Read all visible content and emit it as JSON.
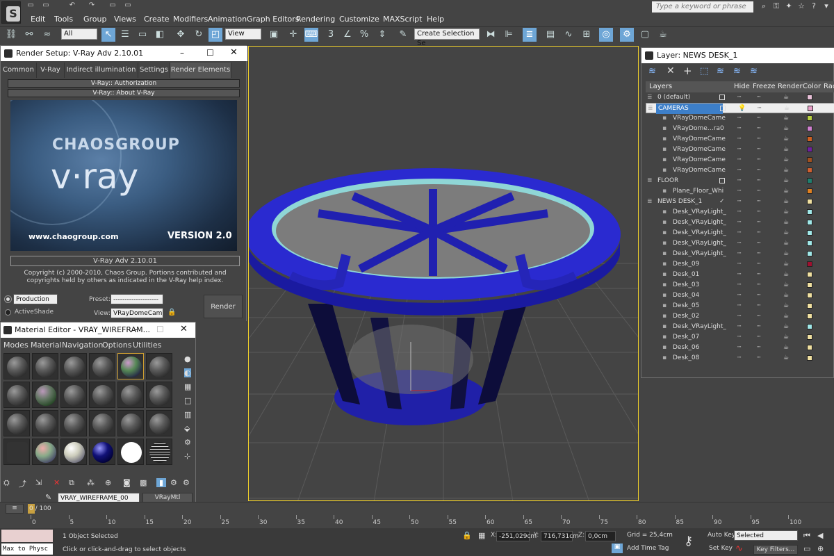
{
  "app": {
    "logo_glyph": "S"
  },
  "qat": [
    "▭",
    "▭",
    "↶",
    "↷",
    "▭",
    "▭"
  ],
  "menu": [
    "Edit",
    "Tools",
    "Group",
    "Views",
    "Create",
    "Modifiers",
    "Animation",
    "Graph Editors",
    "Rendering",
    "Customize",
    "MAXScript",
    "Help"
  ],
  "search": {
    "placeholder": "Type a keyword or phrase"
  },
  "toolbar": {
    "filter": "All",
    "ref_coord": "View",
    "named_selection": "Create Selection Se"
  },
  "render_setup": {
    "title": "Render Setup: V-Ray Adv 2.10.01",
    "tabs": [
      "Common",
      "V-Ray",
      "Indirect illumination",
      "Settings",
      "Render Elements"
    ],
    "rollout_auth": "V-Ray:: Authorization",
    "rollout_about": "V-Ray:: About V-Ray",
    "splash_brand": "CHAOSGROUP",
    "splash_product": "v·ray",
    "splash_url": "www.chaogroup.com",
    "splash_version": "VERSION 2.0",
    "version_label": "V-Ray Adv 2.10.01",
    "copyright": "Copyright (c) 2000-2010, Chaos Group. Portions contributed and copyrights held by others as indicated in the V-Ray help index.",
    "mode_production": "Production",
    "mode_activeshade": "ActiveShade",
    "preset_label": "Preset:",
    "preset_value": "--------------------",
    "view_label": "View:",
    "view_value": "VRayDomeCam",
    "render_button": "Render"
  },
  "material_editor": {
    "title": "Material Editor - VRAY_WIREFRAM...",
    "menu": [
      "Modes",
      "Material",
      "Navigation",
      "Options",
      "Utilities"
    ],
    "material_name": "VRAY_WIREFRAME_00",
    "material_type": "VRayMtl"
  },
  "layer_manager": {
    "title": "Layer: NEWS DESK_1",
    "columns": [
      "Layers",
      "Hide",
      "Freeze",
      "Render",
      "Color",
      "Rad"
    ],
    "rows": [
      {
        "name": "0 (default)",
        "level": 0,
        "color": "#e8c0d8"
      },
      {
        "name": "CAMERAS",
        "level": 0,
        "color": "#e8a0c8",
        "selected": true
      },
      {
        "name": "VRayDomeCame",
        "level": 1,
        "color": "#b8d040"
      },
      {
        "name": "VRayDome…ra0",
        "level": 1,
        "color": "#d080d0"
      },
      {
        "name": "VRayDomeCame",
        "level": 1,
        "color": "#d06020"
      },
      {
        "name": "VRayDomeCame",
        "level": 1,
        "color": "#7020a0"
      },
      {
        "name": "VRayDomeCame",
        "level": 1,
        "color": "#a05020"
      },
      {
        "name": "VRayDomeCame",
        "level": 1,
        "color": "#d06030"
      },
      {
        "name": "FLOOR",
        "level": 0,
        "color": "#208070"
      },
      {
        "name": "Plane_Floor_Whi",
        "level": 1,
        "color": "#e08020"
      },
      {
        "name": "NEWS DESK_1",
        "level": 0,
        "color": "#f0e0a0",
        "current": true
      },
      {
        "name": "Desk_VRayLight_",
        "level": 1,
        "color": "#a0e8e8"
      },
      {
        "name": "Desk_VRayLight_",
        "level": 1,
        "color": "#a0e8e8"
      },
      {
        "name": "Desk_VRayLight_",
        "level": 1,
        "color": "#a0e8e8"
      },
      {
        "name": "Desk_VRayLight_",
        "level": 1,
        "color": "#a0e8e8"
      },
      {
        "name": "Desk_VRayLight_",
        "level": 1,
        "color": "#a0e8e8"
      },
      {
        "name": "Desk_09",
        "level": 1,
        "color": "#a01030"
      },
      {
        "name": "Desk_01",
        "level": 1,
        "color": "#f0e0a0"
      },
      {
        "name": "Desk_03",
        "level": 1,
        "color": "#f0e0a0"
      },
      {
        "name": "Desk_04",
        "level": 1,
        "color": "#f0e0a0"
      },
      {
        "name": "Desk_05",
        "level": 1,
        "color": "#f0e0a0"
      },
      {
        "name": "Desk_02",
        "level": 1,
        "color": "#f0e0a0"
      },
      {
        "name": "Desk_VRayLight_",
        "level": 1,
        "color": "#a0e8e8"
      },
      {
        "name": "Desk_07",
        "level": 1,
        "color": "#f0e0a0"
      },
      {
        "name": "Desk_06",
        "level": 1,
        "color": "#f0e0a0"
      },
      {
        "name": "Desk_08",
        "level": 1,
        "color": "#f0e0a0"
      }
    ]
  },
  "timeline": {
    "frame": "0 / 100",
    "ticks": [
      "0",
      "5",
      "10",
      "15",
      "20",
      "25",
      "30",
      "35",
      "40",
      "45",
      "50",
      "55",
      "60",
      "65",
      "70",
      "75",
      "80",
      "85",
      "90",
      "95",
      "100"
    ]
  },
  "status": {
    "maxscript": "Max to Physc",
    "objects": "1 Object Selected",
    "prompt": "Click or click-and-drag to select objects",
    "x_label": "X:",
    "x": "-251,029cm",
    "y_label": "Y:",
    "y": "716,731cm",
    "z_label": "Z:",
    "z": "0,0cm",
    "grid": "Grid = 25,4cm",
    "add_time_tag": "Add Time Tag",
    "auto_key": "Auto Key",
    "set_key": "Set Key",
    "selected": "Selected",
    "key_filters": "Key Filters..."
  }
}
